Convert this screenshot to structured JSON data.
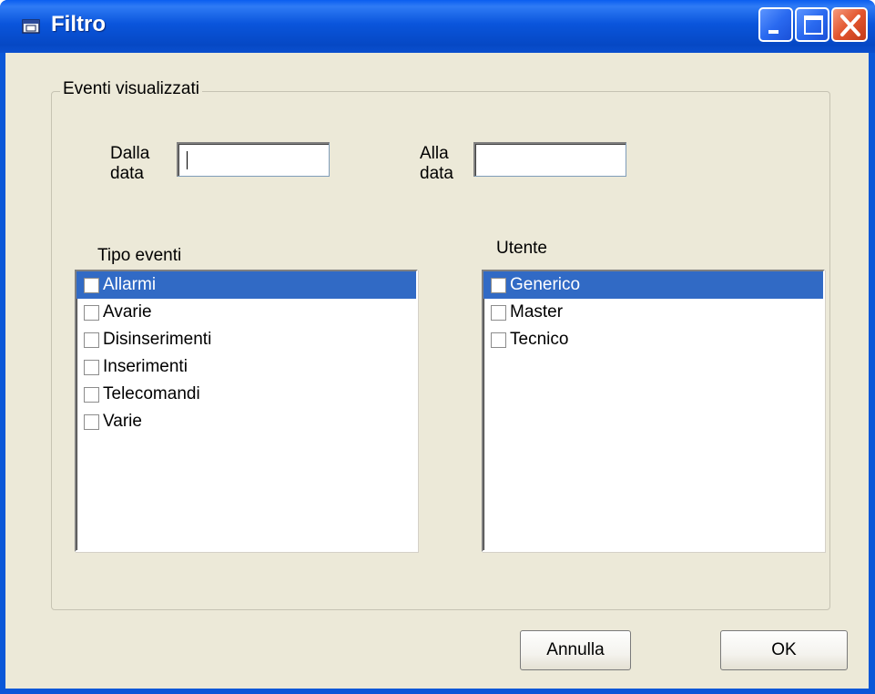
{
  "window": {
    "title": "Filtro",
    "controls": [
      "minimize-icon",
      "maximize-icon",
      "close-icon"
    ],
    "colors": {
      "titlebar": "#0a55dc",
      "client": "#ece9d8",
      "selection": "#316ac5",
      "close": "#e2552e"
    }
  },
  "group": {
    "title": "Eventi visualizzati"
  },
  "from_date": {
    "label_line1": "Dalla",
    "label_line2": "data",
    "value": ""
  },
  "to_date": {
    "label_line1": "Alla",
    "label_line2": "data",
    "value": ""
  },
  "event_types": {
    "label": "Tipo eventi",
    "items": [
      {
        "label": "Allarmi",
        "checked": false,
        "selected": true
      },
      {
        "label": "Avarie",
        "checked": false,
        "selected": false
      },
      {
        "label": "Disinserimenti",
        "checked": false,
        "selected": false
      },
      {
        "label": "Inserimenti",
        "checked": false,
        "selected": false
      },
      {
        "label": "Telecomandi",
        "checked": false,
        "selected": false
      },
      {
        "label": "Varie",
        "checked": false,
        "selected": false
      }
    ]
  },
  "users": {
    "label": "Utente",
    "items": [
      {
        "label": "Generico",
        "checked": false,
        "selected": true
      },
      {
        "label": "Master",
        "checked": false,
        "selected": false
      },
      {
        "label": "Tecnico",
        "checked": false,
        "selected": false
      }
    ]
  },
  "buttons": {
    "cancel": "Annulla",
    "ok": "OK"
  }
}
